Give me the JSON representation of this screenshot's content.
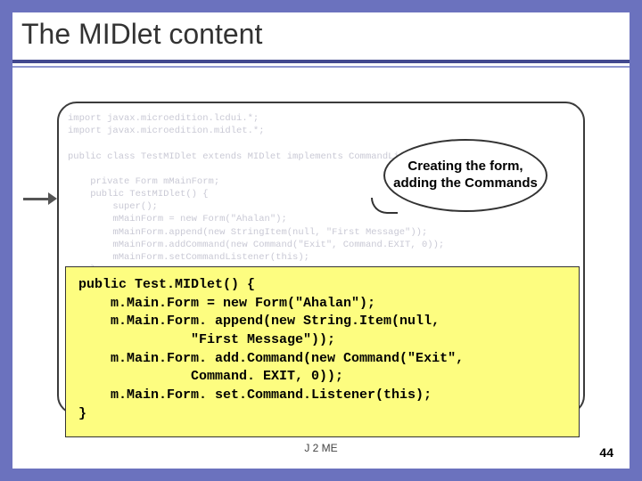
{
  "title": "The MIDlet content",
  "faded_code": "import javax.microedition.lcdui.*;\nimport javax.microedition.midlet.*;\n\npublic class TestMIDlet extends MIDlet implements CommandListener {\n\n    private Form mMainForm;\n    public TestMIDlet() {\n        super();\n        mMainForm = new Form(\"Ahalan\");\n        mMainForm.append(new StringItem(null, \"First Message\"));\n        mMainForm.addCommand(new Command(\"Exit\", Command.EXIT, 0));\n        mMainForm.setCommandListener(this);\n    }",
  "callout_text": "Creating the form, adding the Commands",
  "highlight_code": "public Test.MIDlet() {\n    m.Main.Form = new Form(\"Ahalan\");\n    m.Main.Form. append(new String.Item(null,\n              \"First Message\"));\n    m.Main.Form. add.Command(new Command(\"Exit\",\n              Command. EXIT, 0));\n    m.Main.Form. set.Command.Listener(this);\n}",
  "footer_text": "J 2 ME",
  "page_number": "44"
}
